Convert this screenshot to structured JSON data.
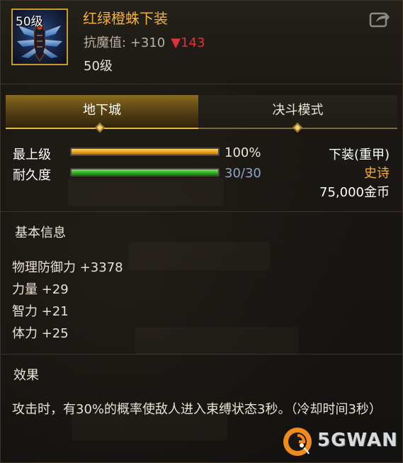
{
  "item": {
    "icon_level": "50级",
    "name": "红绿橙蛛下装",
    "resist_label": "抗魔值:",
    "resist_value": "+310",
    "resist_down_arrow": "▼",
    "resist_down_value": "143",
    "level_requirement": "50级",
    "share_icon": "share-icon"
  },
  "tabs": [
    {
      "label": "地下城",
      "active": true
    },
    {
      "label": "决斗模式",
      "active": false
    }
  ],
  "stats": {
    "upgrade_label": "最上级",
    "upgrade_value": "100%",
    "upgrade_fraction": 1.0,
    "durability_label": "耐久度",
    "durability_value": "30/30",
    "durability_fraction": 1.0
  },
  "info": {
    "slot": "下装(重甲)",
    "rarity": "史诗",
    "price": "75,000金币"
  },
  "basic_info": {
    "title": "基本信息",
    "attributes": [
      "物理防御力 +3378",
      "力量 +29",
      "智力 +21",
      "体力 +25"
    ]
  },
  "effect": {
    "title": "效果",
    "text": "攻击时，有30%的概率使敌人进入束缚状态3秒。（冷却时间3秒）"
  },
  "watermark": {
    "text": "5GWAN"
  },
  "colors": {
    "item_name": "#f2b13a",
    "rarity": "#f2b13a",
    "down_arrow": "#e0303a",
    "durability_value": "#8fa6c7",
    "upgrade_bar": "#e49a1a",
    "durability_bar": "#2fae22"
  }
}
